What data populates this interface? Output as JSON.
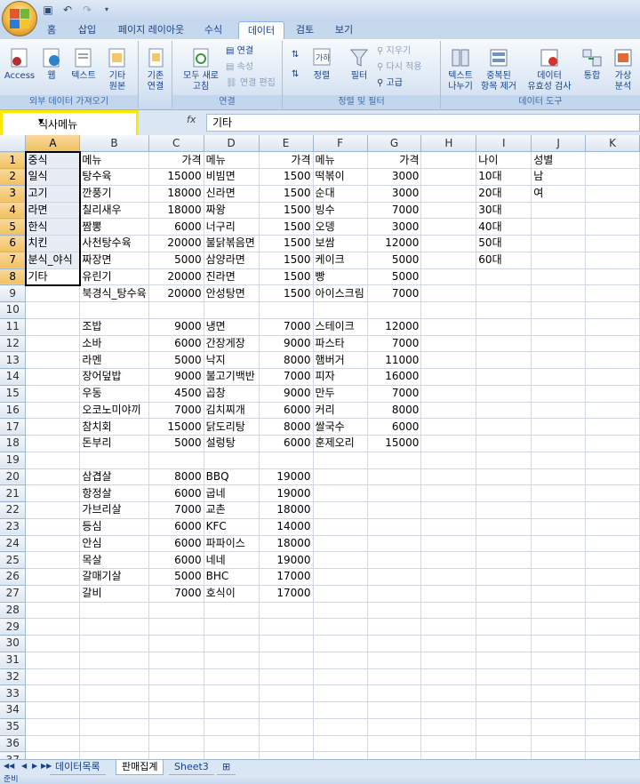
{
  "tabs": [
    "홈",
    "삽입",
    "페이지 레이아웃",
    "수식",
    "데이터",
    "검토",
    "보기"
  ],
  "ribbon": {
    "external": {
      "access": "Access",
      "web": "웹",
      "text": "텍스트",
      "other": "기타",
      "other2": "원본",
      "label": "외부 데이터 가져오기"
    },
    "existing": {
      "l1": "기존",
      "l2": "연결"
    },
    "connections": {
      "refresh1": "모두 새로",
      "refresh2": "고침",
      "conn": "연결",
      "props": "속성",
      "edit": "연결 편집",
      "label": "연결"
    },
    "sort": {
      "sort": "정렬",
      "filter": "필터",
      "clear": "지우기",
      "reapply": "다시 적용",
      "advanced": "고급",
      "label": "정렬 및 필터"
    },
    "tools": {
      "t2c1": "텍스트",
      "t2c2": "나누기",
      "dup1": "중복된",
      "dup2": "항목 제거",
      "val1": "데이터",
      "val2": "유효성 검사",
      "cons": "통합",
      "what1": "가상",
      "what2": "분석",
      "label": "데이터 도구"
    }
  },
  "namebox": "식사메뉴",
  "formula_label": "fx",
  "formula": "기타",
  "columns": [
    "",
    "A",
    "B",
    "C",
    "D",
    "E",
    "F",
    "G",
    "H",
    "I",
    "J",
    "K"
  ],
  "rows": [
    [
      "중식",
      "메뉴",
      "가격",
      "메뉴",
      "가격",
      "메뉴",
      "가격",
      "",
      "나이",
      "성별",
      ""
    ],
    [
      "일식",
      "탕수육",
      "15000",
      "비빔면",
      "1500",
      "떡볶이",
      "3000",
      "",
      "10대",
      "남",
      ""
    ],
    [
      "고기",
      "깐풍기",
      "18000",
      "신라면",
      "1500",
      "순대",
      "3000",
      "",
      "20대",
      "여",
      ""
    ],
    [
      "라면",
      "칠리새우",
      "18000",
      "짜왕",
      "1500",
      "빙수",
      "7000",
      "",
      "30대",
      "",
      ""
    ],
    [
      "한식",
      "짬뽕",
      "6000",
      "너구리",
      "1500",
      "오뎅",
      "3000",
      "",
      "40대",
      "",
      ""
    ],
    [
      "치킨",
      "사천탕수육",
      "20000",
      "불닭볶음면",
      "1500",
      "보쌈",
      "12000",
      "",
      "50대",
      "",
      ""
    ],
    [
      "분식_야식",
      "짜장면",
      "5000",
      "삼양라면",
      "1500",
      "케이크",
      "5000",
      "",
      "60대",
      "",
      ""
    ],
    [
      "기타",
      "유린기",
      "20000",
      "진라면",
      "1500",
      "빵",
      "5000",
      "",
      "",
      "",
      ""
    ],
    [
      "",
      "북경식_탕수육",
      "20000",
      "안성탕면",
      "1500",
      "아이스크림",
      "7000",
      "",
      "",
      "",
      ""
    ],
    [
      "",
      "",
      "",
      "",
      "",
      "",
      "",
      "",
      "",
      "",
      ""
    ],
    [
      "",
      "조밥",
      "9000",
      "냉면",
      "7000",
      "스테이크",
      "12000",
      "",
      "",
      "",
      ""
    ],
    [
      "",
      "소바",
      "6000",
      "간장게장",
      "9000",
      "파스타",
      "7000",
      "",
      "",
      "",
      ""
    ],
    [
      "",
      "라멘",
      "5000",
      "낙지",
      "8000",
      "햄버거",
      "11000",
      "",
      "",
      "",
      ""
    ],
    [
      "",
      "장어덮밥",
      "9000",
      "불고기백반",
      "7000",
      "피자",
      "16000",
      "",
      "",
      "",
      ""
    ],
    [
      "",
      "우동",
      "4500",
      "곱창",
      "9000",
      "만두",
      "7000",
      "",
      "",
      "",
      ""
    ],
    [
      "",
      "오코노미야끼",
      "7000",
      "김치찌개",
      "6000",
      "커리",
      "8000",
      "",
      "",
      "",
      ""
    ],
    [
      "",
      "참치회",
      "15000",
      "닭도리탕",
      "8000",
      "쌀국수",
      "6000",
      "",
      "",
      "",
      ""
    ],
    [
      "",
      "돈부리",
      "5000",
      "설렁탕",
      "6000",
      "훈제오리",
      "15000",
      "",
      "",
      "",
      ""
    ],
    [
      "",
      "",
      "",
      "",
      "",
      "",
      "",
      "",
      "",
      "",
      ""
    ],
    [
      "",
      "삼겹살",
      "8000",
      "BBQ",
      "19000",
      "",
      "",
      "",
      "",
      "",
      ""
    ],
    [
      "",
      "항정살",
      "6000",
      "굽네",
      "19000",
      "",
      "",
      "",
      "",
      "",
      ""
    ],
    [
      "",
      "가브리살",
      "7000",
      "교촌",
      "18000",
      "",
      "",
      "",
      "",
      "",
      ""
    ],
    [
      "",
      "등심",
      "6000",
      "KFC",
      "14000",
      "",
      "",
      "",
      "",
      "",
      ""
    ],
    [
      "",
      "안심",
      "6000",
      "파파이스",
      "18000",
      "",
      "",
      "",
      "",
      "",
      ""
    ],
    [
      "",
      "목살",
      "6000",
      "네네",
      "19000",
      "",
      "",
      "",
      "",
      "",
      ""
    ],
    [
      "",
      "갈매기살",
      "5000",
      "BHC",
      "17000",
      "",
      "",
      "",
      "",
      "",
      ""
    ],
    [
      "",
      "갈비",
      "7000",
      "호식이",
      "17000",
      "",
      "",
      "",
      "",
      "",
      ""
    ],
    [
      "",
      "",
      "",
      "",
      "",
      "",
      "",
      "",
      "",
      "",
      ""
    ],
    [
      "",
      "",
      "",
      "",
      "",
      "",
      "",
      "",
      "",
      "",
      ""
    ],
    [
      "",
      "",
      "",
      "",
      "",
      "",
      "",
      "",
      "",
      "",
      ""
    ],
    [
      "",
      "",
      "",
      "",
      "",
      "",
      "",
      "",
      "",
      "",
      ""
    ],
    [
      "",
      "",
      "",
      "",
      "",
      "",
      "",
      "",
      "",
      "",
      ""
    ],
    [
      "",
      "",
      "",
      "",
      "",
      "",
      "",
      "",
      "",
      "",
      ""
    ],
    [
      "",
      "",
      "",
      "",
      "",
      "",
      "",
      "",
      "",
      "",
      ""
    ],
    [
      "",
      "",
      "",
      "",
      "",
      "",
      "",
      "",
      "",
      "",
      ""
    ],
    [
      "",
      "",
      "",
      "",
      "",
      "",
      "",
      "",
      "",
      "",
      ""
    ],
    [
      "",
      "",
      "",
      "",
      "",
      "",
      "",
      "",
      "",
      "",
      ""
    ]
  ],
  "sheets": [
    "데이터목록",
    "판매집계",
    "Sheet3"
  ],
  "status": "준비"
}
